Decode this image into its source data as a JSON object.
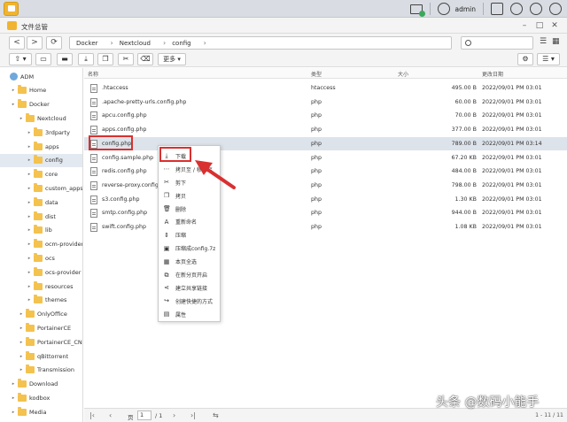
{
  "system": {
    "user": "admin"
  },
  "window": {
    "title": "文件总管",
    "minimize": "–",
    "maximize": "□",
    "close": "✕"
  },
  "nav": {
    "back": "<",
    "forward": ">",
    "refresh": "⟳",
    "breadcrumb": [
      "Docker",
      "Nextcloud",
      "config"
    ],
    "search_placeholder": ""
  },
  "toolbar": {
    "upload": "⇧ ▾",
    "new_folder": "⊞",
    "more_label": "更多 ▾"
  },
  "columns": {
    "name": "名称",
    "type": "类型",
    "size": "大小",
    "modified": "更改日期"
  },
  "sidebar": {
    "items": [
      {
        "label": "ADM",
        "depth": 0,
        "root": true
      },
      {
        "label": "Home",
        "depth": 1
      },
      {
        "label": "Docker",
        "depth": 1
      },
      {
        "label": "Nextcloud",
        "depth": 2
      },
      {
        "label": "3rdparty",
        "depth": 3
      },
      {
        "label": "apps",
        "depth": 3
      },
      {
        "label": "config",
        "depth": 3,
        "selected": true
      },
      {
        "label": "core",
        "depth": 3
      },
      {
        "label": "custom_apps",
        "depth": 3
      },
      {
        "label": "data",
        "depth": 3
      },
      {
        "label": "dist",
        "depth": 3
      },
      {
        "label": "lib",
        "depth": 3
      },
      {
        "label": "ocm-provider",
        "depth": 3
      },
      {
        "label": "ocs",
        "depth": 3
      },
      {
        "label": "ocs-provider",
        "depth": 3
      },
      {
        "label": "resources",
        "depth": 3
      },
      {
        "label": "themes",
        "depth": 3
      },
      {
        "label": "OnlyOffice",
        "depth": 2
      },
      {
        "label": "PortainerCE",
        "depth": 2
      },
      {
        "label": "PortainerCE_CN",
        "depth": 2
      },
      {
        "label": "qBittorrent",
        "depth": 2
      },
      {
        "label": "Transmission",
        "depth": 2
      },
      {
        "label": "Download",
        "depth": 1
      },
      {
        "label": "kodbox",
        "depth": 1
      },
      {
        "label": "Media",
        "depth": 1
      }
    ]
  },
  "files": [
    {
      "name": ".htaccess",
      "type": "htaccess",
      "size": "495.00 B",
      "date": "2022/09/01 PM 03:01"
    },
    {
      "name": ".apache-pretty-urls.config.php",
      "type": "php",
      "size": "60.00 B",
      "date": "2022/09/01 PM 03:01"
    },
    {
      "name": "apcu.config.php",
      "type": "php",
      "size": "70.00 B",
      "date": "2022/09/01 PM 03:01"
    },
    {
      "name": "apps.config.php",
      "type": "php",
      "size": "377.00 B",
      "date": "2022/09/01 PM 03:01"
    },
    {
      "name": "config.php",
      "type": "php",
      "size": "789.00 B",
      "date": "2022/09/01 PM 03:14",
      "selected": true
    },
    {
      "name": "config.sample.php",
      "type": "php",
      "size": "67.20 KB",
      "date": "2022/09/01 PM 03:01"
    },
    {
      "name": "redis.config.php",
      "type": "php",
      "size": "484.00 B",
      "date": "2022/09/01 PM 03:01"
    },
    {
      "name": "reverse-proxy.config.php",
      "type": "php",
      "size": "798.00 B",
      "date": "2022/09/01 PM 03:01"
    },
    {
      "name": "s3.config.php",
      "type": "php",
      "size": "1.30 KB",
      "date": "2022/09/01 PM 03:01"
    },
    {
      "name": "smtp.config.php",
      "type": "php",
      "size": "944.00 B",
      "date": "2022/09/01 PM 03:01"
    },
    {
      "name": "swift.config.php",
      "type": "php",
      "size": "1.08 KB",
      "date": "2022/09/01 PM 03:01"
    }
  ],
  "context_menu": [
    {
      "label": "下载",
      "icon": "download-icon",
      "glyph": "⤓"
    },
    {
      "label": "拷贝至 / 移动至",
      "icon": "more-icon",
      "glyph": "⋯"
    },
    {
      "label": "剪下",
      "icon": "cut-icon",
      "glyph": "✂"
    },
    {
      "label": "拷贝",
      "icon": "copy-icon",
      "glyph": "❐"
    },
    {
      "label": "删除",
      "icon": "trash-icon",
      "glyph": "🗑"
    },
    {
      "label": "重新命名",
      "icon": "rename-icon",
      "glyph": "A"
    },
    {
      "label": "压缩",
      "icon": "compress-icon",
      "glyph": "⇕"
    },
    {
      "label": "压缩成config.7z",
      "icon": "archive-icon",
      "glyph": "▣"
    },
    {
      "label": "本页全选",
      "icon": "select-all-icon",
      "glyph": "▦"
    },
    {
      "label": "在新分页开启",
      "icon": "new-tab-icon",
      "glyph": "⧉"
    },
    {
      "label": "建立共享链接",
      "icon": "share-icon",
      "glyph": "⋖"
    },
    {
      "label": "创建快捷的方式",
      "icon": "shortcut-icon",
      "glyph": "↪"
    },
    {
      "label": "属性",
      "icon": "properties-icon",
      "glyph": "▤"
    }
  ],
  "pager": {
    "page_label": "页",
    "page": "1",
    "total": "/ 1",
    "count": "1 - 11 / 11"
  },
  "watermark": "头条 @数码小能手",
  "colors": {
    "accent_red": "#d93030",
    "folder": "#f3c24f",
    "selection": "#dde3ea"
  }
}
